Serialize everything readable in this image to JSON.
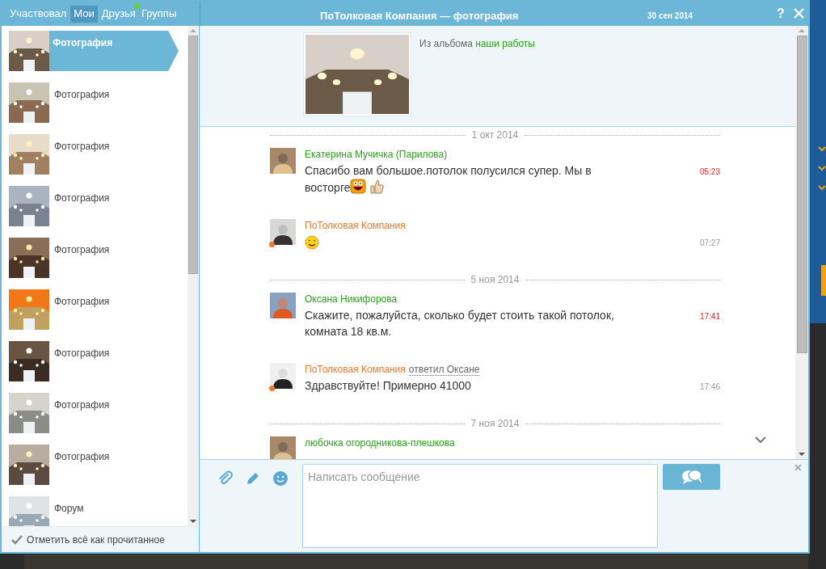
{
  "tabs": [
    {
      "label": "Участвовал",
      "selected": false,
      "notify": false
    },
    {
      "label": "Мои",
      "selected": true,
      "notify": false
    },
    {
      "label": "Друзья",
      "selected": false,
      "notify": true
    },
    {
      "label": "Группы",
      "selected": false,
      "notify": false
    }
  ],
  "title": "ПоТолковая Компания — фотография",
  "date": "30 сен 2014",
  "help": "?",
  "conversations": [
    {
      "title": "Фотография",
      "selected": true
    },
    {
      "title": "Фотография",
      "selected": false
    },
    {
      "title": "Фотография",
      "selected": false
    },
    {
      "title": "Фотография",
      "selected": false
    },
    {
      "title": "Фотография",
      "selected": false
    },
    {
      "title": "Фотография",
      "selected": false
    },
    {
      "title": "Фотография",
      "selected": false
    },
    {
      "title": "Фотография",
      "selected": false
    },
    {
      "title": "Фотография",
      "selected": false
    },
    {
      "title": "Форум",
      "selected": false
    }
  ],
  "mark_all_read": "Отметить всё как прочитанное",
  "album": {
    "prefix": "Из альбома",
    "link": "наши работы"
  },
  "feed": [
    {
      "kind": "date",
      "text": "1 окт 2014"
    },
    {
      "kind": "message",
      "author": "Екатерина Мучичка (Парилова)",
      "color": "#2ca01c",
      "text": "Спасибо вам большое.потолок полусился супер. Мы в восторге",
      "emojis": [
        {
          "kind": "laugh"
        },
        {
          "kind": "thumbs_up"
        }
      ],
      "time": "05:23",
      "unread": true,
      "badge": false
    },
    {
      "kind": "message",
      "author": "ПоТолковая Компания",
      "color": "#ee7733",
      "emojis": [
        {
          "kind": "smile"
        }
      ],
      "time": "07:27",
      "unread": false,
      "badge": true
    },
    {
      "kind": "date",
      "text": "5 ноя 2014"
    },
    {
      "kind": "message",
      "author": "Оксана Никифорова",
      "color": "#2ca01c",
      "text": "Скажите, пожалуйста, сколько будет стоить такой потолок, комната 18 кв.м.",
      "time": "17:41",
      "unread": true,
      "badge": false
    },
    {
      "kind": "message",
      "author": "ПоТолковая Компания",
      "color": "#ee7733",
      "reply_note": "ответил Оксане",
      "text": "Здравствуйте! Примерно 41000",
      "time": "17:46",
      "unread": false,
      "badge": true
    },
    {
      "kind": "date",
      "text": "7 ноя 2014"
    },
    {
      "kind": "message",
      "author": "любочка огородникова-плешкова",
      "color": "#2ca01c"
    }
  ],
  "composer": {
    "placeholder": "Написать сообщение"
  }
}
